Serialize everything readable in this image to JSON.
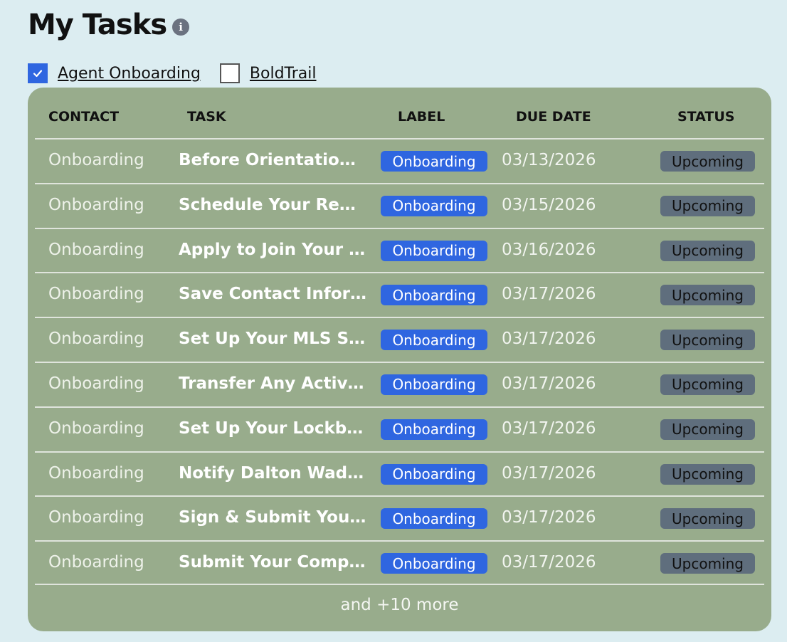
{
  "header": {
    "title": "My Tasks",
    "info_icon": "info-icon"
  },
  "filters": [
    {
      "label": "Agent Onboarding",
      "checked": true
    },
    {
      "label": "BoldTrail",
      "checked": false
    }
  ],
  "table": {
    "columns": [
      "CONTACT",
      "TASK",
      "LABEL",
      "DUE DATE",
      "STATUS"
    ],
    "rows": [
      {
        "contact": "Onboarding",
        "task": "Before Orientation: L…",
        "label": "Onboarding",
        "due_date": "03/13/2026",
        "status": "Upcoming"
      },
      {
        "contact": "Onboarding",
        "task": "Schedule Your Requir…",
        "label": "Onboarding",
        "due_date": "03/15/2026",
        "status": "Upcoming"
      },
      {
        "contact": "Onboarding",
        "task": "Apply to Join Your Loc…",
        "label": "Onboarding",
        "due_date": "03/16/2026",
        "status": "Upcoming"
      },
      {
        "contact": "Onboarding",
        "task": "Save Contact Informa…",
        "label": "Onboarding",
        "due_date": "03/17/2026",
        "status": "Upcoming"
      },
      {
        "contact": "Onboarding",
        "task": "Set Up Your MLS Subs…",
        "label": "Onboarding",
        "due_date": "03/17/2026",
        "status": "Upcoming"
      },
      {
        "contact": "Onboarding",
        "task": "Transfer Any Active Li…",
        "label": "Onboarding",
        "due_date": "03/17/2026",
        "status": "Upcoming"
      },
      {
        "contact": "Onboarding",
        "task": "Set Up Your Lockbox …",
        "label": "Onboarding",
        "due_date": "03/17/2026",
        "status": "Upcoming"
      },
      {
        "contact": "Onboarding",
        "task": "Notify Dalton Wade S…",
        "label": "Onboarding",
        "due_date": "03/17/2026",
        "status": "Upcoming"
      },
      {
        "contact": "Onboarding",
        "task": "Sign & Submit Your Of…",
        "label": "Onboarding",
        "due_date": "03/17/2026",
        "status": "Upcoming"
      },
      {
        "contact": "Onboarding",
        "task": "Submit Your Complet…",
        "label": "Onboarding",
        "due_date": "03/17/2026",
        "status": "Upcoming"
      }
    ],
    "more_text": "and +10 more"
  },
  "colors": {
    "background": "#dcedf1",
    "card": "#98ac8c",
    "label_badge": "#2f66e0",
    "status_badge": "#5f6e7d",
    "checkbox_checked": "#2f66e0"
  }
}
